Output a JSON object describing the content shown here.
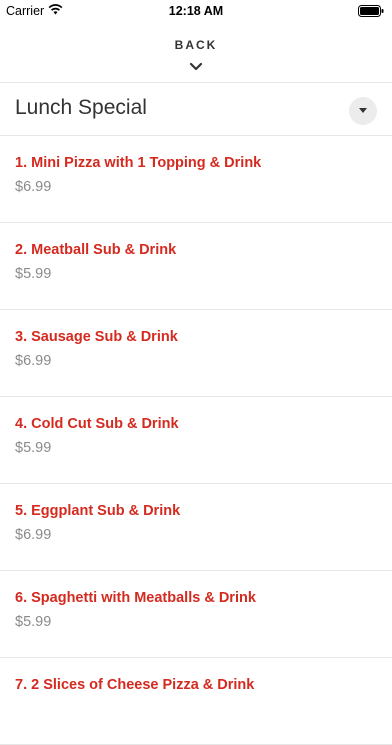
{
  "status_bar": {
    "carrier": "Carrier",
    "time": "12:18 AM"
  },
  "nav": {
    "back_label": "BACK"
  },
  "section": {
    "title": "Lunch Special"
  },
  "items": [
    {
      "name": "1. Mini Pizza with 1 Topping & Drink",
      "price": "$6.99"
    },
    {
      "name": "2. Meatball Sub & Drink",
      "price": "$5.99"
    },
    {
      "name": "3. Sausage Sub & Drink",
      "price": "$6.99"
    },
    {
      "name": "4. Cold Cut Sub & Drink",
      "price": "$5.99"
    },
    {
      "name": "5. Eggplant Sub & Drink",
      "price": "$6.99"
    },
    {
      "name": "6. Spaghetti with Meatballs & Drink",
      "price": "$5.99"
    },
    {
      "name": "7. 2 Slices of Cheese Pizza & Drink",
      "price": ""
    }
  ],
  "colors": {
    "accent": "#d42a1f",
    "price": "#8a8a8a"
  },
  "icons": {
    "wifi": "wifi-icon",
    "battery": "battery-icon",
    "back": "chevron-down-icon",
    "toggle": "caret-down-icon"
  }
}
